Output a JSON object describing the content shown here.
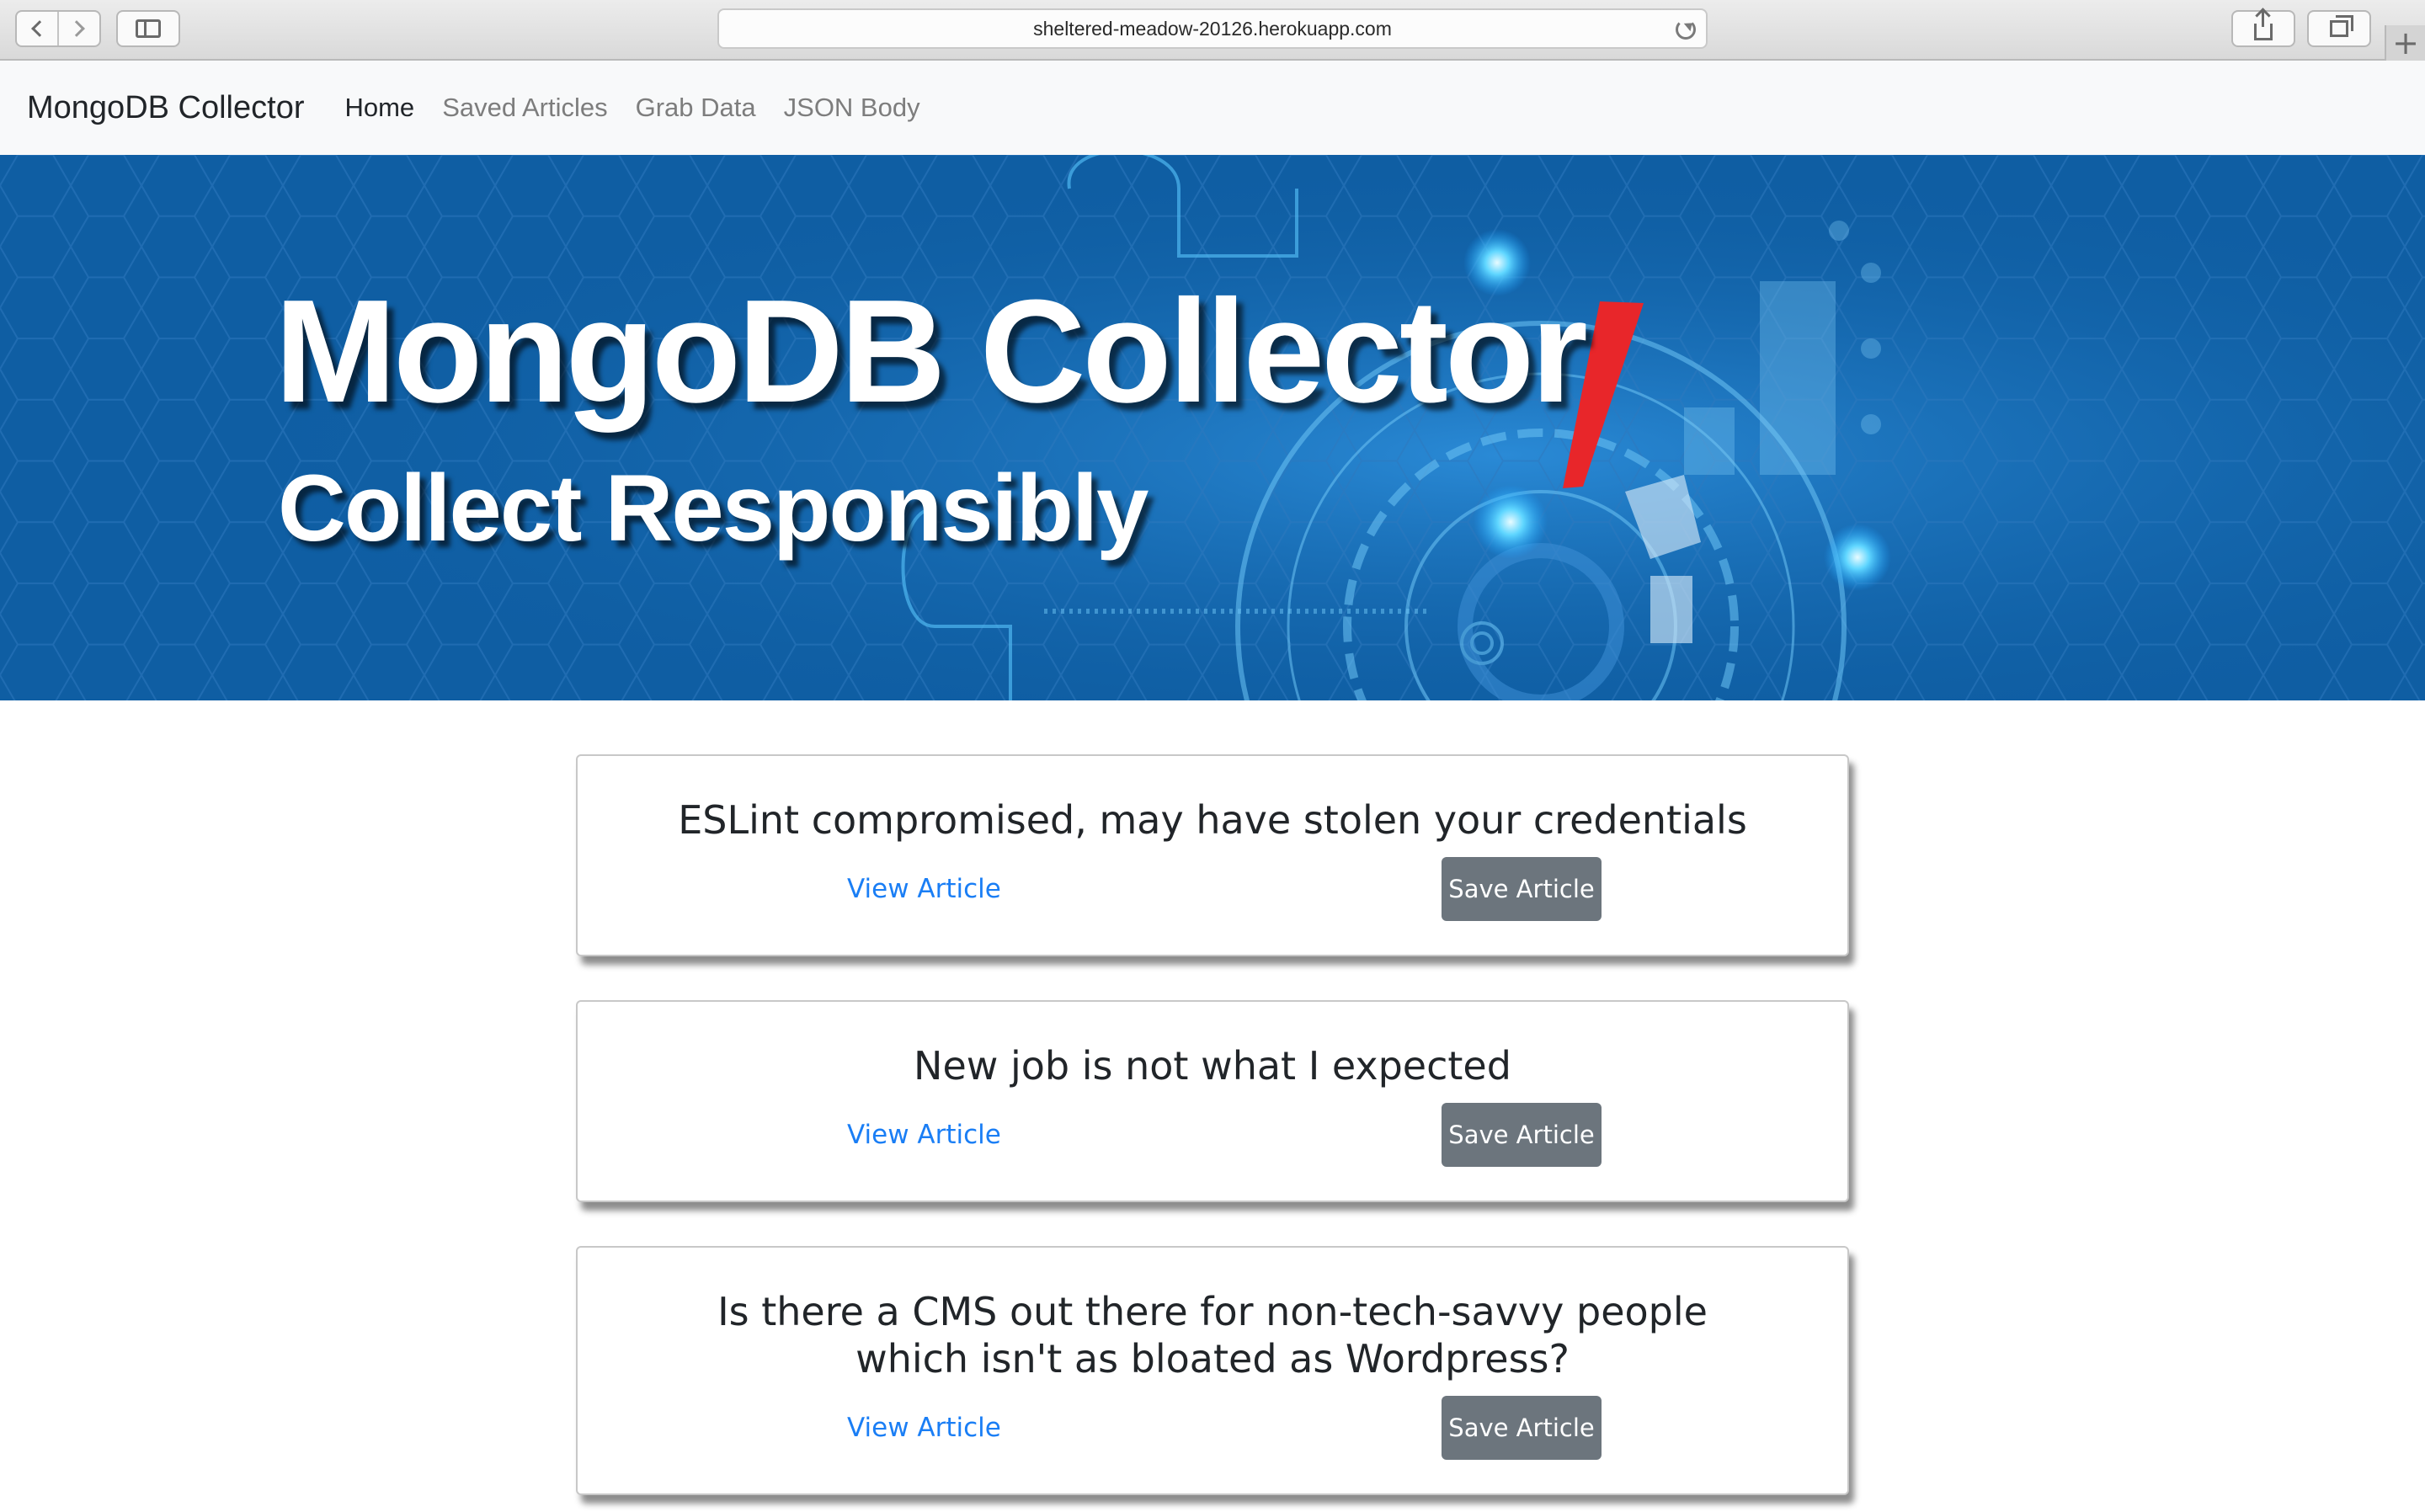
{
  "browser": {
    "url": "sheltered-meadow-20126.herokuapp.com"
  },
  "navbar": {
    "brand": "MongoDB Collector",
    "links": [
      {
        "label": "Home"
      },
      {
        "label": "Saved Articles"
      },
      {
        "label": "Grab Data"
      },
      {
        "label": "JSON Body"
      }
    ]
  },
  "hero": {
    "title": "MongoDB Collector",
    "subtitle": "Collect Responsibly"
  },
  "articles": [
    {
      "title": "ESLint compromised, may have stolen your credentials",
      "view_label": "View Article",
      "save_label": "Save Article"
    },
    {
      "title": "New job is not what I expected",
      "view_label": "View Article",
      "save_label": "Save Article"
    },
    {
      "title": "Is there a CMS out there for non-tech-savvy people which isn't as bloated as Wordpress?",
      "view_label": "View Article",
      "save_label": "Save Article"
    }
  ],
  "colors": {
    "hero_bg": "#0f5ea3",
    "link": "#1a7ef5",
    "button": "#6c757d",
    "navbar_bg": "#f8f9fa"
  }
}
